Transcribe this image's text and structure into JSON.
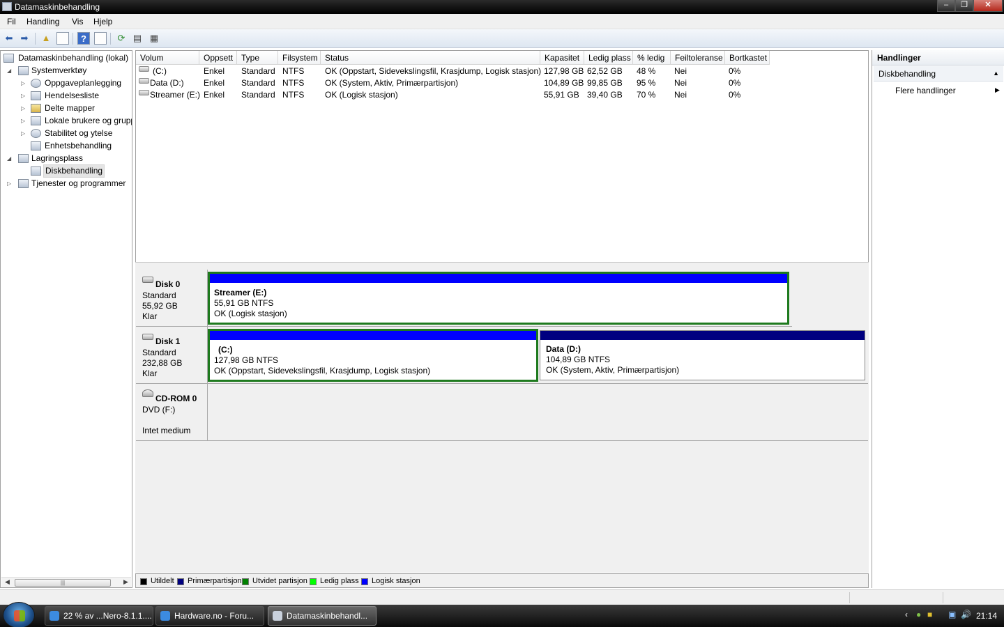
{
  "window": {
    "title": "Datamaskinbehandling"
  },
  "menu": [
    {
      "label": "Fil"
    },
    {
      "label": "Handling"
    },
    {
      "label": "Vis"
    },
    {
      "label": "Hjelp"
    }
  ],
  "tree": {
    "root": "Datamaskinbehandling (lokal)",
    "items": [
      {
        "label": "Systemverktøy"
      },
      {
        "label": "Oppgaveplanlegging"
      },
      {
        "label": "Hendelsesliste"
      },
      {
        "label": "Delte mapper"
      },
      {
        "label": "Lokale brukere og grupp"
      },
      {
        "label": "Stabilitet og ytelse"
      },
      {
        "label": "Enhetsbehandling"
      },
      {
        "label": "Lagringsplass"
      },
      {
        "label": "Diskbehandling"
      },
      {
        "label": "Tjenester og programmer"
      }
    ]
  },
  "volume_table": {
    "columns": [
      "Volum",
      "Oppsett",
      "Type",
      "Filsystem",
      "Status",
      "Kapasitet",
      "Ledig plass",
      "% ledig",
      "Feiltoleranse",
      "Bortkastet"
    ],
    "rows": [
      {
        "volum": "(C:)",
        "oppsett": "Enkel",
        "type": "Standard",
        "filsystem": "NTFS",
        "status": "OK (Oppstart, Sidevekslingsfil, Krasjdump, Logisk stasjon)",
        "kapasitet": "127,98 GB",
        "ledig": "62,52 GB",
        "prosent": "48 %",
        "feiltoleranse": "Nei",
        "bortkastet": "0%"
      },
      {
        "volum": "Data (D:)",
        "oppsett": "Enkel",
        "type": "Standard",
        "filsystem": "NTFS",
        "status": "OK (System, Aktiv, Primærpartisjon)",
        "kapasitet": "104,89 GB",
        "ledig": "99,85 GB",
        "prosent": "95 %",
        "feiltoleranse": "Nei",
        "bortkastet": "0%"
      },
      {
        "volum": "Streamer (E:)",
        "oppsett": "Enkel",
        "type": "Standard",
        "filsystem": "NTFS",
        "status": "OK (Logisk stasjon)",
        "kapasitet": "55,91 GB",
        "ledig": "39,40 GB",
        "prosent": "70 %",
        "feiltoleranse": "Nei",
        "bortkastet": "0%"
      }
    ]
  },
  "disks": [
    {
      "name": "Disk 0",
      "type": "Standard",
      "size": "55,92 GB",
      "state": "Klar",
      "partitions": [
        {
          "title": "Streamer  (E:)",
          "size": "55,91 GB NTFS",
          "status": "OK (Logisk stasjon)",
          "bar_color": "#0000ff"
        }
      ]
    },
    {
      "name": "Disk 1",
      "type": "Standard",
      "size": "232,88 GB",
      "state": "Klar",
      "partitions": [
        {
          "title": "(C:)",
          "size": "127,98 GB NTFS",
          "status": "OK (Oppstart, Sidevekslingsfil, Krasjdump, Logisk stasjon)",
          "bar_color": "#0000ff"
        },
        {
          "title": "Data  (D:)",
          "size": "104,89 GB NTFS",
          "status": "OK (System, Aktiv, Primærpartisjon)",
          "bar_color": "#000080"
        }
      ]
    },
    {
      "name": "CD-ROM 0",
      "type": "DVD (F:)",
      "state": "Intet medium"
    }
  ],
  "legend": [
    {
      "label": "Utildelt",
      "color": "#000000"
    },
    {
      "label": "Primærpartisjon",
      "color": "#000080"
    },
    {
      "label": "Utvidet partisjon",
      "color": "#008000"
    },
    {
      "label": "Ledig plass",
      "color": "#00ff00"
    },
    {
      "label": "Logisk stasjon",
      "color": "#0000ff"
    }
  ],
  "actions": {
    "header": "Handlinger",
    "group": "Diskbehandling",
    "items": [
      {
        "label": "Flere handlinger"
      }
    ]
  },
  "taskbar": {
    "buttons": [
      {
        "label": "22 % av ...Nero-8.1.1...."
      },
      {
        "label": "Hardware.no - Foru..."
      },
      {
        "label": "Datamaskinbehandl..."
      }
    ],
    "clock": "21:14"
  }
}
